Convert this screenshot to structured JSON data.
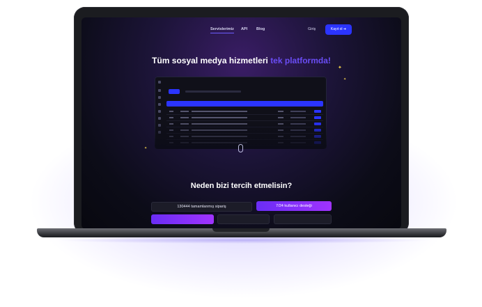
{
  "nav": {
    "links": [
      "Servislerimiz",
      "API",
      "Blog"
    ],
    "login": "Giriş",
    "register": "Kayıt ol"
  },
  "hero": {
    "title_main": "Tüm sosyal medya hizmetleri",
    "title_accent": "tek platformda!"
  },
  "why_title": "Neden bizi tercih etmelisin?",
  "stats": {
    "orders": "130444 tamamlanmış sipariş",
    "support": "7/24 kullanıcı desteği"
  },
  "colors": {
    "accent": "#2b34ff",
    "purple": "#7a2df5",
    "highlight": "#6a4df5"
  }
}
